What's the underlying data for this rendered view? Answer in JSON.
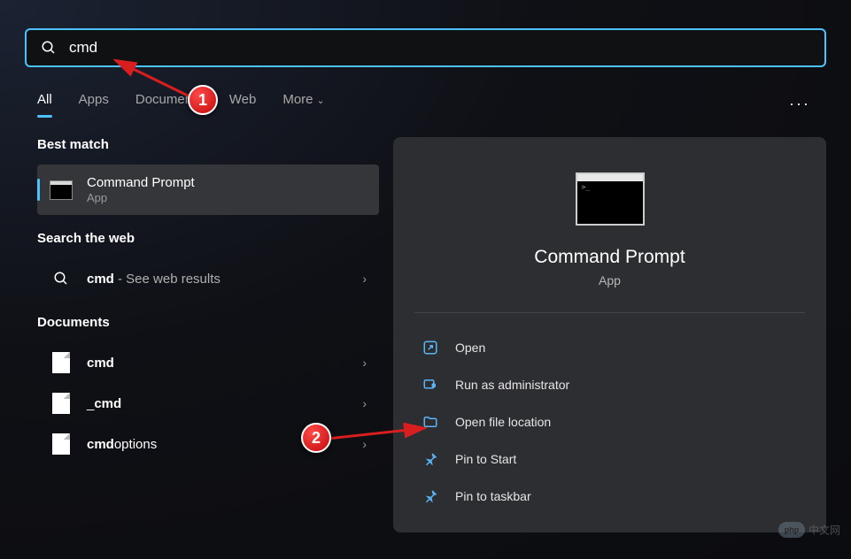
{
  "search": {
    "value": "cmd"
  },
  "tabs": [
    "All",
    "Apps",
    "Documents",
    "Web",
    "More"
  ],
  "active_tab": 0,
  "sections": {
    "best": {
      "heading": "Best match",
      "item": {
        "title": "Command Prompt",
        "subtitle": "App"
      }
    },
    "web": {
      "heading": "Search the web",
      "item": {
        "prefix": "cmd",
        "suffix": " - See web results"
      }
    },
    "docs": {
      "heading": "Documents",
      "items": [
        {
          "bold": "cmd",
          "rest": ""
        },
        {
          "bold": "",
          "rest": "_",
          "bold2": "cmd"
        },
        {
          "bold": "cmd",
          "rest": "options"
        }
      ]
    }
  },
  "details": {
    "title": "Command Prompt",
    "subtitle": "App",
    "actions": [
      "Open",
      "Run as administrator",
      "Open file location",
      "Pin to Start",
      "Pin to taskbar"
    ]
  },
  "annotations": {
    "1": "1",
    "2": "2"
  },
  "watermark": "中文网"
}
